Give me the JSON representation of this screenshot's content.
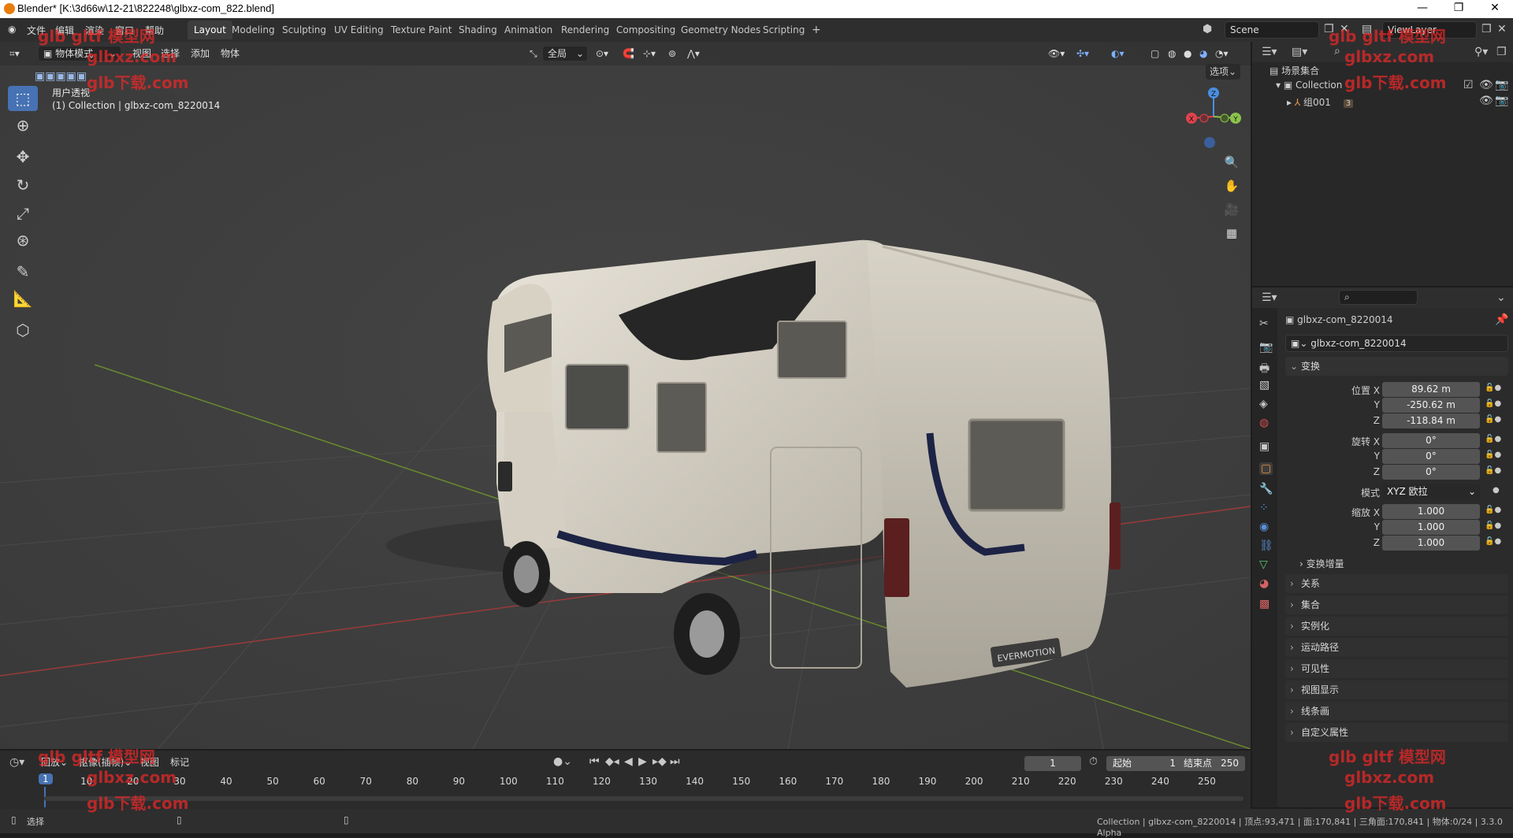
{
  "window": {
    "title": "Blender* [K:\\3d66w\\12-21\\822248\\glbxz-com_822.blend]",
    "minimize": "—",
    "restore": "❐",
    "close": "✕"
  },
  "topbar": {
    "menus": [
      "文件",
      "编辑",
      "渲染",
      "窗口",
      "帮助"
    ],
    "workspaces": [
      "Layout",
      "Modeling",
      "Sculpting",
      "UV Editing",
      "Texture Paint",
      "Shading",
      "Animation",
      "Rendering",
      "Compositing",
      "Geometry Nodes",
      "Scripting"
    ],
    "active_workspace": "Layout",
    "add_tab": "+",
    "scene_label": "Scene",
    "viewlayer_label": "ViewLayer"
  },
  "viewport": {
    "mode_dropdown": "物体模式",
    "menus": [
      "视图",
      "选择",
      "添加",
      "物体"
    ],
    "transform_orientation": "全局",
    "options_label": "选项",
    "view_name": "用户透视",
    "collection_info": "(1) Collection | glbxz-com_8220014",
    "gizmo": {
      "x": "X",
      "y": "Y",
      "z": "Z"
    },
    "truck_logo": "EVERMOTION"
  },
  "toolbar": {
    "tools": [
      "select-box-icon",
      "cursor-icon",
      "move-icon",
      "rotate-icon",
      "scale-icon",
      "transform-icon",
      "annotate-icon",
      "measure-icon",
      "add-cube-icon"
    ]
  },
  "outliner": {
    "root": "场景集合",
    "collection": "Collection",
    "child": "组001",
    "child_badge": "3"
  },
  "properties": {
    "object_name": "glbxz-com_8220014",
    "data_name": "glbxz-com_8220014",
    "transform_section": "变换",
    "location_label": "位置 X",
    "location": [
      "89.62 m",
      "-250.62 m",
      "-118.84 m"
    ],
    "rotation_label": "旋转 X",
    "rotation": [
      "0°",
      "0°",
      "0°"
    ],
    "mode_label": "模式",
    "mode_value": "XYZ 欧拉",
    "scale_label": "缩放 X",
    "scale": [
      "1.000",
      "1.000",
      "1.000"
    ],
    "axis_y": "Y",
    "axis_z": "Z",
    "delta_transform": "变换增量",
    "panels": [
      "关系",
      "集合",
      "实例化",
      "运动路径",
      "可见性",
      "视图显示",
      "线条画",
      "自定义属性"
    ]
  },
  "timeline": {
    "menus": [
      "回放",
      "抠像(插帧)",
      "视图",
      "标记"
    ],
    "current_frame": "1",
    "start_label": "起始",
    "start_value": "1",
    "end_label": "结束点",
    "end_value": "250",
    "ticks": [
      "1",
      "10",
      "20",
      "30",
      "40",
      "50",
      "60",
      "70",
      "80",
      "90",
      "100",
      "110",
      "120",
      "130",
      "140",
      "150",
      "160",
      "170",
      "180",
      "190",
      "200",
      "210",
      "220",
      "230",
      "240",
      "250"
    ]
  },
  "statusbar": {
    "left_label": "选择",
    "info": "Collection | glbxz-com_8220014 | 顶点:93,471 | 面:170,841 | 三角面:170,841 | 物体:0/24 | 3.3.0 Alpha"
  },
  "watermarks": {
    "line1": "glb gltf 模型网",
    "line2": "glbxz.com",
    "line3": "glb下载.com"
  },
  "colors": {
    "accent": "#4772b3",
    "x_axis": "#e0424e",
    "y_axis": "#8bc34a",
    "z_axis": "#4a8fe0"
  }
}
